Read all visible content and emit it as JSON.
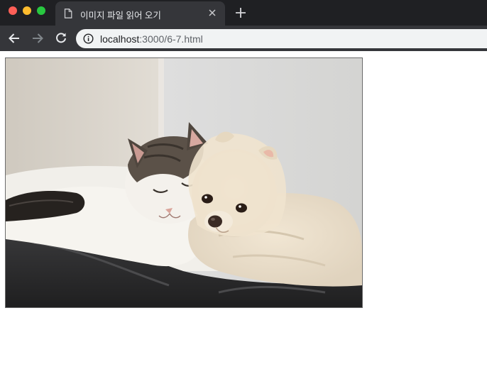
{
  "window": {
    "tab_title": "이미지 파일 읽어 오기",
    "tab_icon": "document-icon",
    "close_tab_icon": "close-icon",
    "new_tab_icon": "plus-icon"
  },
  "toolbar": {
    "back_icon": "arrow-left-icon",
    "forward_icon": "arrow-right-icon",
    "reload_icon": "reload-icon",
    "site_info_icon": "info-icon",
    "url_host": "localhost",
    "url_rest": ":3000/6-7.html"
  },
  "content": {
    "image": {
      "subject": "photo of a tabby-and-white cat and a cream Pomeranian dog cuddling on a bed",
      "border_color": "#6b6b6b"
    }
  },
  "colors": {
    "tabbar_bg": "#1f2023",
    "active_tab_bg": "#35363a",
    "omnibox_bg": "#f1f3f4",
    "close_dot": "#fe5f57",
    "minimize_dot": "#febc2e",
    "maximize_dot": "#28c840"
  }
}
